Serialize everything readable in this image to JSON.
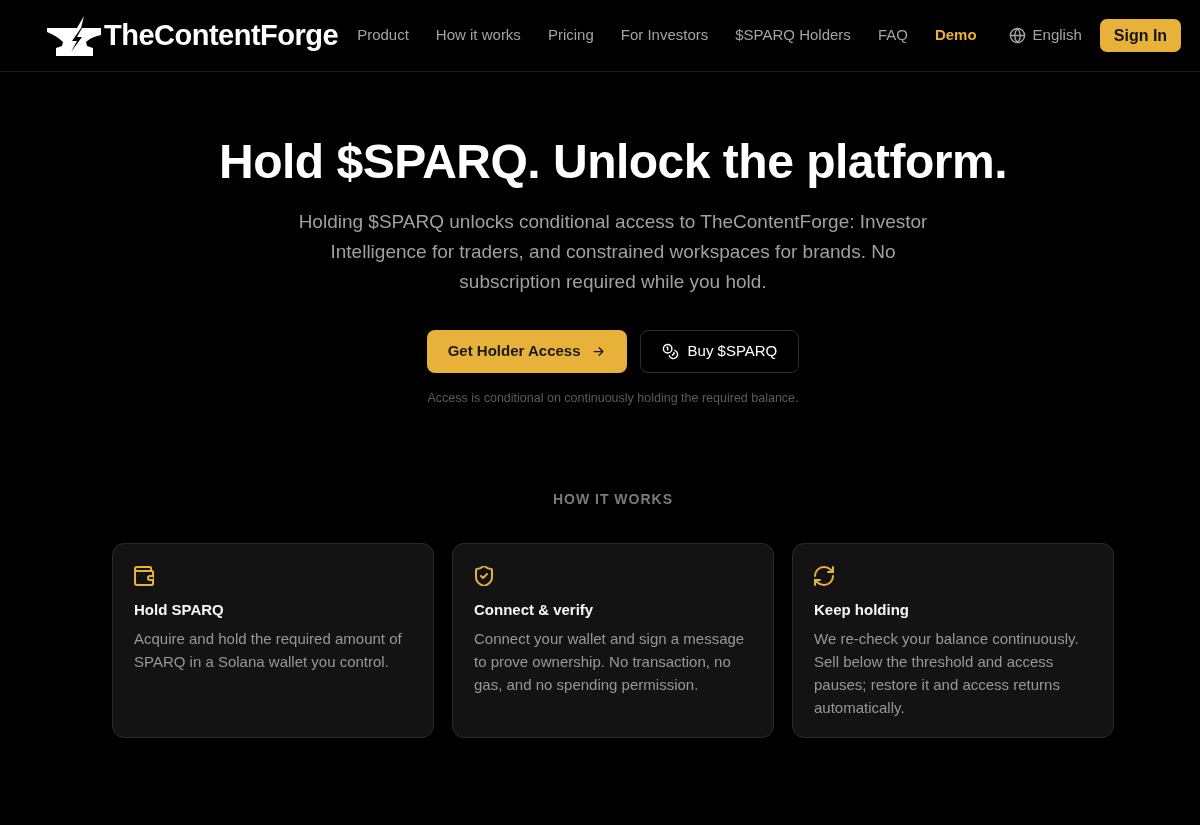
{
  "header": {
    "brand": "TheContentForge",
    "nav": [
      {
        "label": "Product",
        "accent": false
      },
      {
        "label": "How it works",
        "accent": false
      },
      {
        "label": "Pricing",
        "accent": false
      },
      {
        "label": "For Investors",
        "accent": false
      },
      {
        "label": "$SPARQ Holders",
        "accent": false
      },
      {
        "label": "FAQ",
        "accent": false
      },
      {
        "label": "Demo",
        "accent": true
      }
    ],
    "language": {
      "label": "English"
    },
    "sign_in": {
      "label": "Sign In"
    }
  },
  "hero": {
    "title": "Hold $SPARQ. Unlock the platform.",
    "subtitle": "Holding $SPARQ unlocks conditional access to TheContentForge: Investor Intelligence for traders, and constrained workspaces for brands. No subscription required while you hold.",
    "buttons": [
      {
        "label": "Get Holder Access",
        "kind": "primary"
      },
      {
        "label": "Buy $SPARQ",
        "kind": "secondary"
      }
    ],
    "note": "Access is conditional on continuously holding the required balance."
  },
  "how_it_works": {
    "heading": "HOW IT WORKS",
    "steps": [
      {
        "title": "Hold SPARQ",
        "description": "Acquire and hold the required amount of SPARQ in a Solana wallet you control."
      },
      {
        "title": "Connect & verify",
        "description": "Connect your wallet and sign a message to prove ownership. No transaction, no gas, and no spending permission."
      },
      {
        "title": "Keep holding",
        "description": "We re-check your balance continuously. Sell below the threshold and access pauses; restore it and access returns automatically."
      }
    ]
  }
}
